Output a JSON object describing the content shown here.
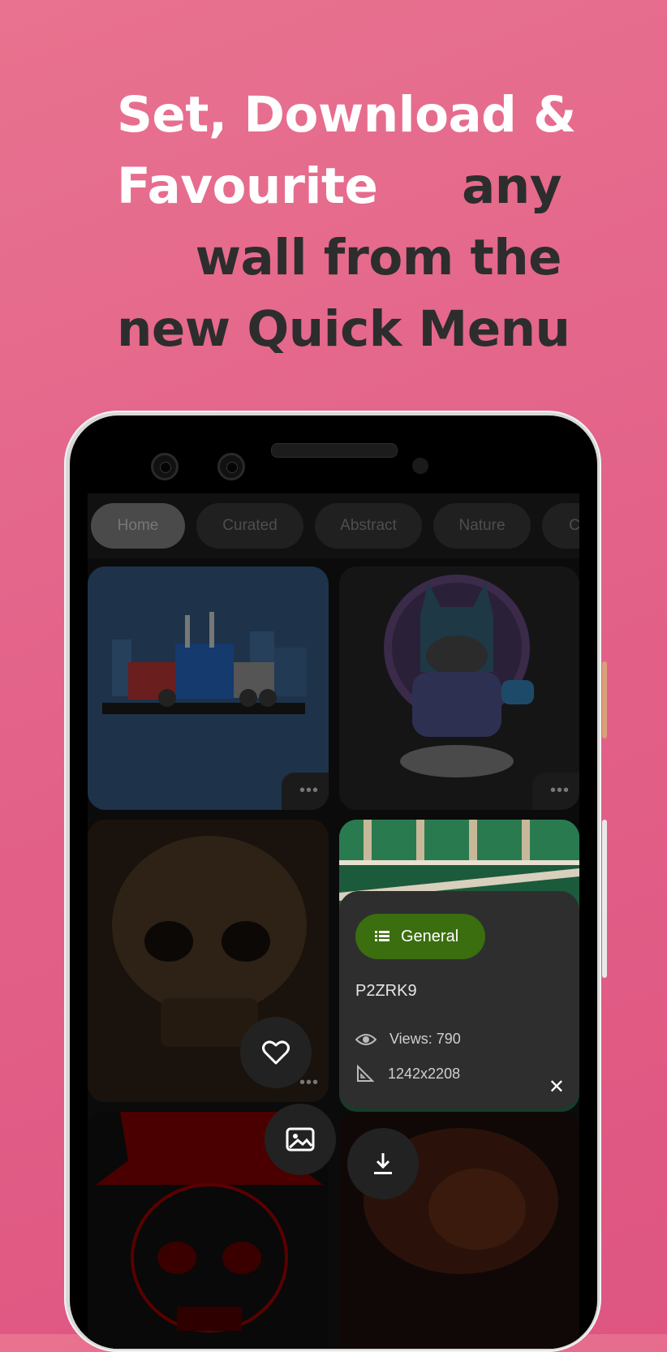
{
  "headline": {
    "line1": "Set, Download &",
    "line2_light": "Favourite",
    "line2_dark": "any",
    "line3": "wall from the",
    "line4": "new Quick Menu"
  },
  "tabs": [
    {
      "label": "Home",
      "active": true
    },
    {
      "label": "Curated",
      "active": false
    },
    {
      "label": "Abstract",
      "active": false
    },
    {
      "label": "Nature",
      "active": false
    },
    {
      "label": "C",
      "active": false
    }
  ],
  "tile_menu_label": "•••",
  "quick_menu": {
    "category_label": "General",
    "category_icon": "list-icon",
    "wallpaper_id": "P2ZRK9",
    "views_label": "Views: 790",
    "resolution_label": "1242x2208",
    "close_label": "✕"
  },
  "fab_buttons": [
    "favourite",
    "set-wallpaper",
    "download"
  ],
  "colors": {
    "background": "#e3638a",
    "accent_chip": "#3a6e0f",
    "headline_light": "#ffffff",
    "headline_dark": "#2d2d2d"
  }
}
